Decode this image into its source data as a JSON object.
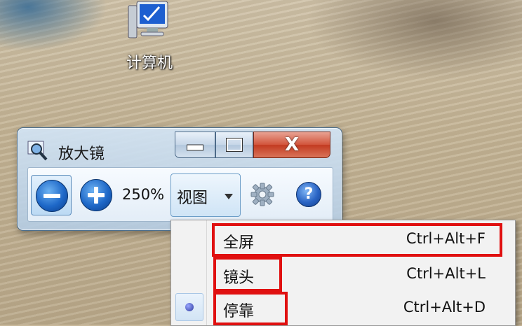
{
  "desktop": {
    "icon_label": "计算机"
  },
  "magnifier": {
    "title": "放大镜",
    "zoom_level": "250%",
    "views_label": "视图",
    "help_label": "?",
    "close_label": "X"
  },
  "menu": {
    "items": [
      {
        "label": "全屏",
        "shortcut": "Ctrl+Alt+F",
        "selected": false,
        "highlighted": true
      },
      {
        "label": "镜头",
        "shortcut": "Ctrl+Alt+L",
        "selected": false,
        "highlighted": true
      },
      {
        "label": "停靠",
        "shortcut": "Ctrl+Alt+D",
        "selected": true,
        "highlighted": true
      }
    ]
  },
  "colors": {
    "highlight_box": "#e01010",
    "window_frame": "#b4cde6",
    "close_button": "#c23a20"
  },
  "icons": [
    "computer-icon",
    "magnifier-icon",
    "minimize-icon",
    "maximize-icon",
    "close-icon",
    "zoom-out-icon",
    "zoom-in-icon",
    "chevron-down-icon",
    "gear-icon",
    "help-icon",
    "radio-dot-icon"
  ]
}
